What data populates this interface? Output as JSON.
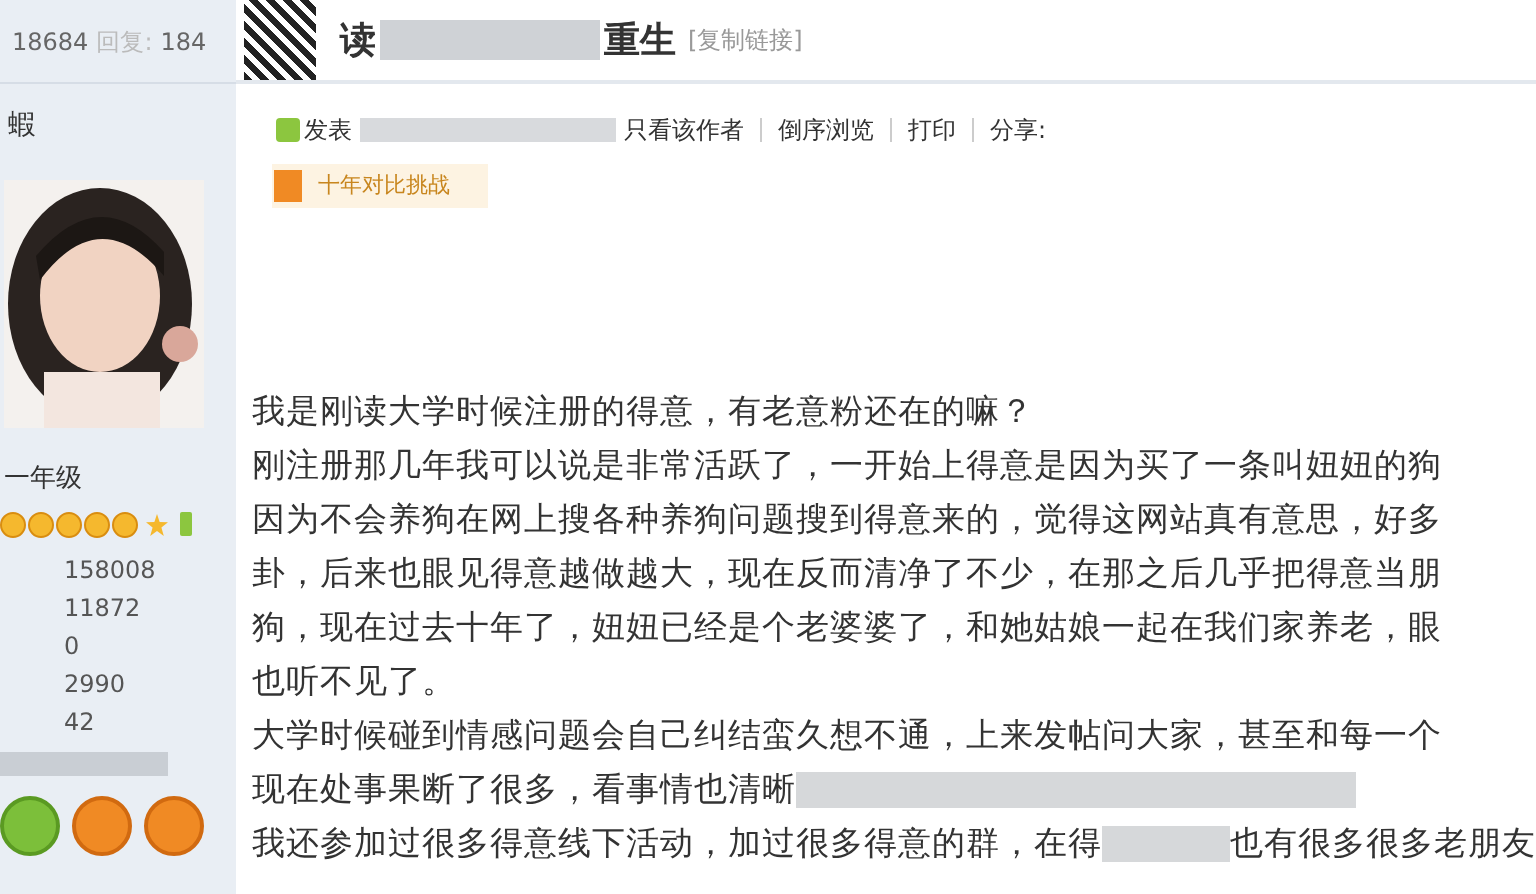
{
  "sidebar": {
    "views": "18684",
    "replies_label": "回复:",
    "replies": "184",
    "username": "蝦",
    "rank": "一年级",
    "stats": [
      "158008",
      "11872",
      "0",
      "2990",
      "42"
    ]
  },
  "post": {
    "title_start": "读",
    "title_end": "重生",
    "copy_link": "[复制链接]",
    "meta": {
      "posted": "发表",
      "actions": [
        "只看该作者",
        "倒序浏览",
        "打印",
        "分享:"
      ]
    },
    "badge": "十年对比挑战",
    "lines": [
      {
        "text": "我是刚读大学时候注册的得意，有老意粉还在的嘛？"
      },
      {
        "text": "刚注册那几年我可以说是非常活跃了，一开始上得意是因为买了一条叫妞妞的狗"
      },
      {
        "text": "因为不会养狗在网上搜各种养狗问题搜到得意来的，觉得这网站真有意思，好多"
      },
      {
        "text": "卦，后来也眼见得意越做越大，现在反而清净了不少，在那之后几乎把得意当朋"
      },
      {
        "text": "狗，现在过去十年了，妞妞已经是个老婆婆了，和她姑娘一起在我们家养老，眼"
      },
      {
        "text": "也听不见了。"
      },
      {
        "text": "大学时候碰到情感问题会自己纠结蛮久想不通，上来发帖问大家，甚至和每一个"
      },
      {
        "text": "现在处事果断了很多，看事情也清晰",
        "blurred_after": true
      },
      {
        "text": "我还参加过很多得意线下活动，加过很多得意的群，在得",
        "blurred_after": true,
        "tail": "也有很多很多老朋友"
      }
    ]
  }
}
